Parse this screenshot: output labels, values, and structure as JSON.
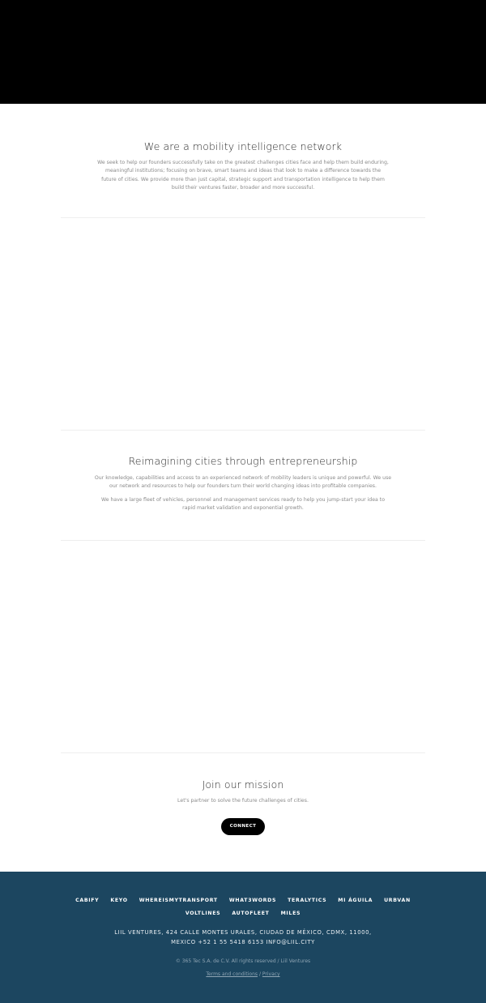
{
  "hero": {},
  "intro": {
    "title": "We are a mobility intelligence network",
    "body": "We seek to help our founders successfully take on the greatest challenges cities face and help them build enduring, meaningful institutions; focusing on brave, smart teams and ideas that look to make a difference towards the future of cities. We provide more than just capital, strategic support and transportation intelligence to help them build their ventures faster, broader and more successful."
  },
  "reimagining": {
    "title": "Reimagining cities through entrepreneurship",
    "paragraph1": "Our knowledge, capabilities and access to an experienced network of mobility leaders is unique and powerful. We use our network and resources to help our founders turn their world changing ideas into profitable companies.",
    "paragraph2": "We have a large fleet of vehicles, personnel and management services ready to help you jump-start your idea to rapid market validation and exponential growth."
  },
  "join": {
    "title": "Join our mission",
    "subtitle": "Let's partner to solve the future challenges of cities.",
    "button_label": "CONNECT"
  },
  "footer": {
    "background_color": "#1c4660",
    "partners": [
      "CABIFY",
      "KEYO",
      "WHEREISMYTRANSPORT",
      "WHAT3WORDS",
      "TERALYTICS",
      "MI ÁGUILA",
      "URBVAN",
      "VOLTLINES",
      "AUTOFLEET",
      "MILES"
    ],
    "address": "LIIL VENTURES, 424 CALLE MONTES URALES, CIUDAD DE MÉXICO, CDMX, 11000, MEXICO   +52 1 55 5418 6153   INFO@LIIL.CITY",
    "copyright": "© 365 Tec S.A. de C.V. All rights reserved / Liil Ventures",
    "terms_label": "Terms and conditions",
    "separator": " / ",
    "privacy_label": "Privacy"
  }
}
